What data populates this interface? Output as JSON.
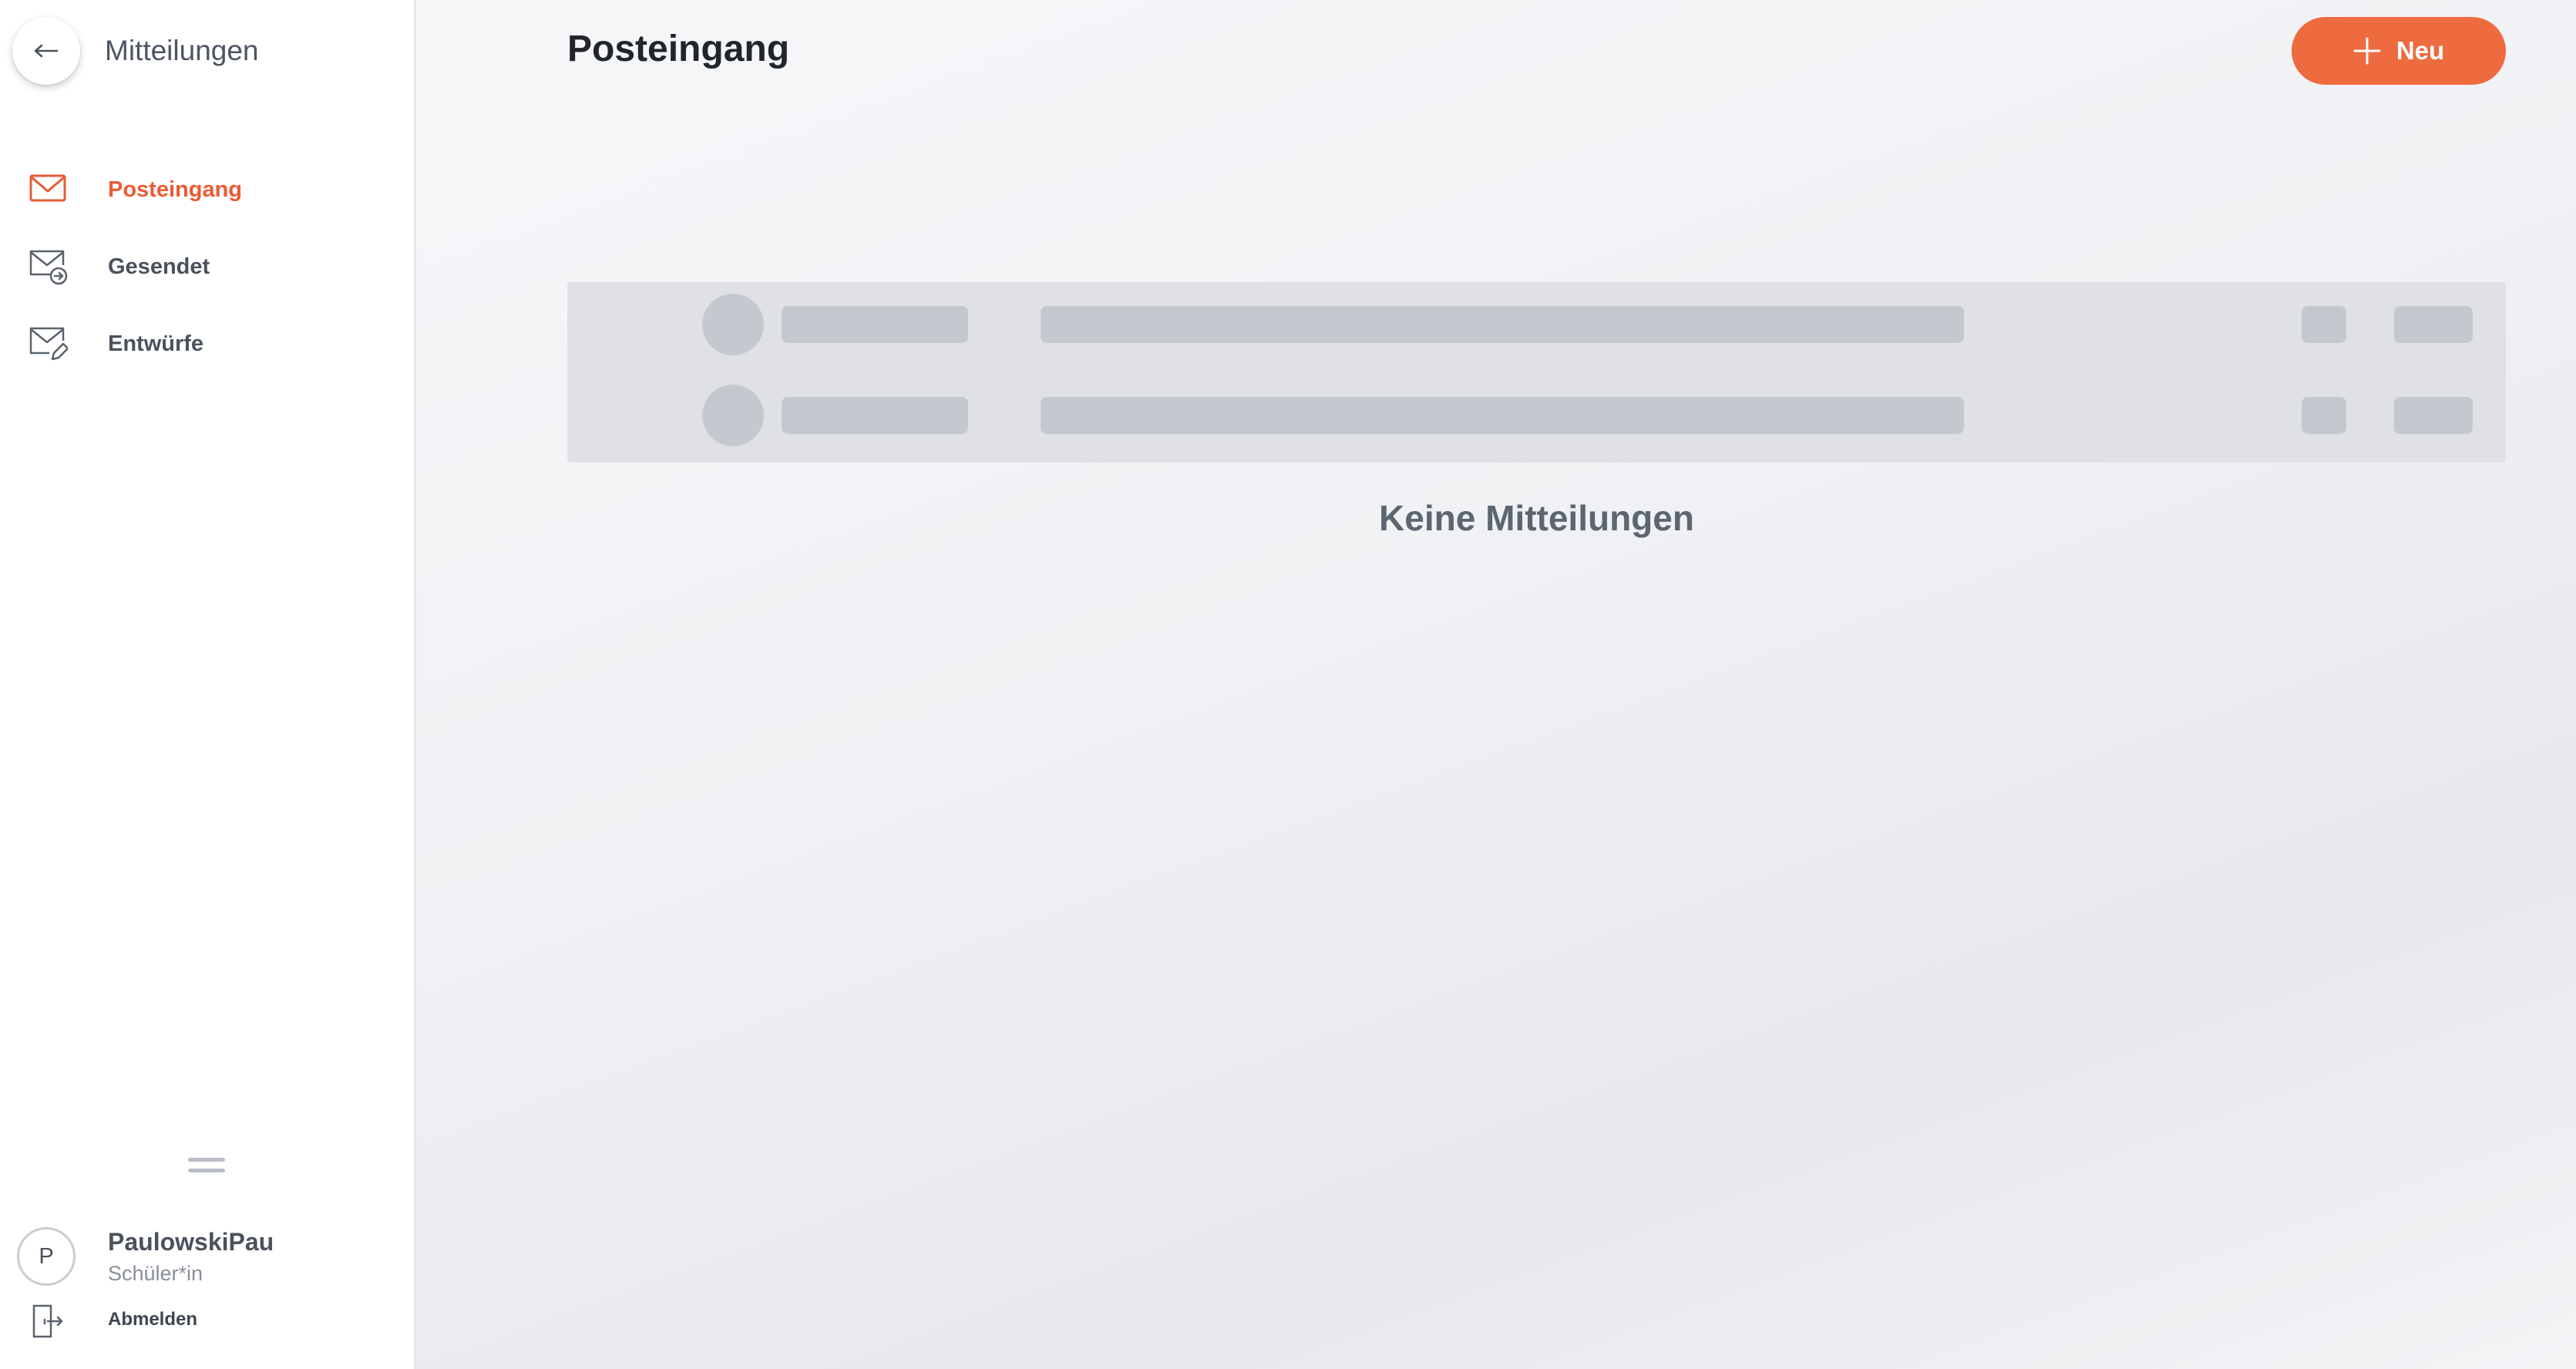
{
  "sidebar": {
    "title": "Mitteilungen",
    "back_icon": "arrow-left-icon",
    "items": [
      {
        "label": "Posteingang",
        "icon": "envelope-icon",
        "active": true
      },
      {
        "label": "Gesendet",
        "icon": "envelope-sent-icon",
        "active": false
      },
      {
        "label": "Entwürfe",
        "icon": "envelope-draft-icon",
        "active": false
      }
    ],
    "user": {
      "initial": "P",
      "name": "PaulowskiPau",
      "role": "Schüler*in"
    },
    "logout_label": "Abmelden"
  },
  "main": {
    "title": "Posteingang",
    "new_button_label": "Neu",
    "empty_text": "Keine Mitteilungen"
  },
  "colors": {
    "accent": "#ee6a3f",
    "active_text": "#ea5b33",
    "skeleton": "#c4c9cf",
    "skeleton_bg": "#dfe1e5"
  }
}
